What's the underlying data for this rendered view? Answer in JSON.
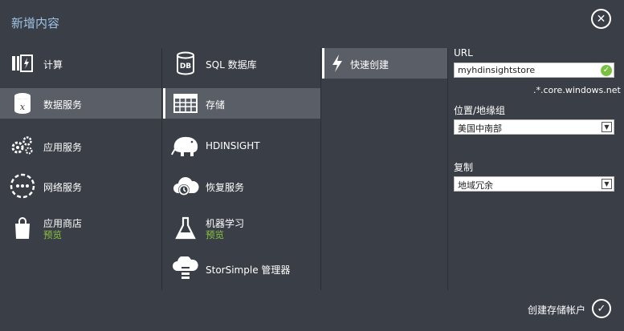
{
  "title": "新增内容",
  "close_icon": "close-icon",
  "categories": [
    {
      "label": "计算",
      "icon": "compute-icon"
    },
    {
      "label": "数据服务",
      "icon": "data-services-icon",
      "selected": true
    },
    {
      "label": "应用服务",
      "icon": "app-services-icon"
    },
    {
      "label": "网络服务",
      "icon": "network-services-icon"
    },
    {
      "label": "应用商店",
      "sub": "预览",
      "icon": "store-icon"
    }
  ],
  "services": [
    {
      "label": "SQL 数据库",
      "icon": "sql-database-icon"
    },
    {
      "label": "存储",
      "icon": "storage-icon",
      "selected": true
    },
    {
      "label": "HDINSIGHT",
      "icon": "hdinsight-icon"
    },
    {
      "label": "恢复服务",
      "icon": "recovery-services-icon"
    },
    {
      "label": "机器学习",
      "sub": "预览",
      "icon": "machine-learning-icon"
    },
    {
      "label": "StorSimple 管理器",
      "icon": "storsimple-icon"
    }
  ],
  "actions": [
    {
      "label": "快速创建",
      "icon": "quick-create-icon",
      "selected": true
    }
  ],
  "form": {
    "url_label": "URL",
    "url_value": "myhdinsightstore",
    "url_suffix": ".*.core.windows.net",
    "location_label": "位置/地缘组",
    "location_value": "美国中南部",
    "replication_label": "复制",
    "replication_value": "地域冗余"
  },
  "create_label": "创建存储帐户",
  "colors": {
    "background": "#3a3e46",
    "selected": "#5a5e66",
    "title": "#9fc3e6",
    "preview": "#8cc63f",
    "valid": "#7ac142"
  }
}
